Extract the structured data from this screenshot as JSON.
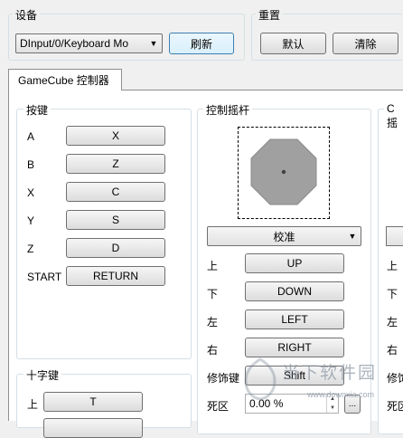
{
  "device": {
    "group_title": "设备",
    "selected": "DInput/0/Keyboard Mo",
    "refresh_label": "刷新"
  },
  "reset": {
    "group_title": "重置",
    "default_label": "默认",
    "clear_label": "清除"
  },
  "tab": {
    "label": "GameCube 控制器"
  },
  "buttons_group": {
    "title": "按键",
    "rows": [
      {
        "label": "A",
        "value": "X"
      },
      {
        "label": "B",
        "value": "Z"
      },
      {
        "label": "X",
        "value": "C"
      },
      {
        "label": "Y",
        "value": "S"
      },
      {
        "label": "Z",
        "value": "D"
      },
      {
        "label": "START",
        "value": "RETURN"
      }
    ]
  },
  "dpad_group": {
    "title": "十字键",
    "rows": [
      {
        "label": "上",
        "value": "T"
      }
    ]
  },
  "stick_group": {
    "title": "控制摇杆",
    "calibrate_label": "校准",
    "rows": [
      {
        "label": "上",
        "value": "UP"
      },
      {
        "label": "下",
        "value": "DOWN"
      },
      {
        "label": "左",
        "value": "LEFT"
      },
      {
        "label": "右",
        "value": "RIGHT"
      },
      {
        "label": "修饰键",
        "value": "Shift"
      }
    ],
    "deadzone_label": "死区",
    "deadzone_value": "0.00 %",
    "more_label": "..."
  },
  "cstick_group": {
    "title": "C 摇",
    "rows": [
      "上",
      "下",
      "左",
      "右",
      "修饰",
      "死区"
    ]
  },
  "watermark": {
    "text_cn": "当下软件园",
    "text_url": "www.downxia.com"
  },
  "colors": {
    "accent_focus": "#3c7fb1",
    "stick_fill": "#a0a0a0"
  }
}
